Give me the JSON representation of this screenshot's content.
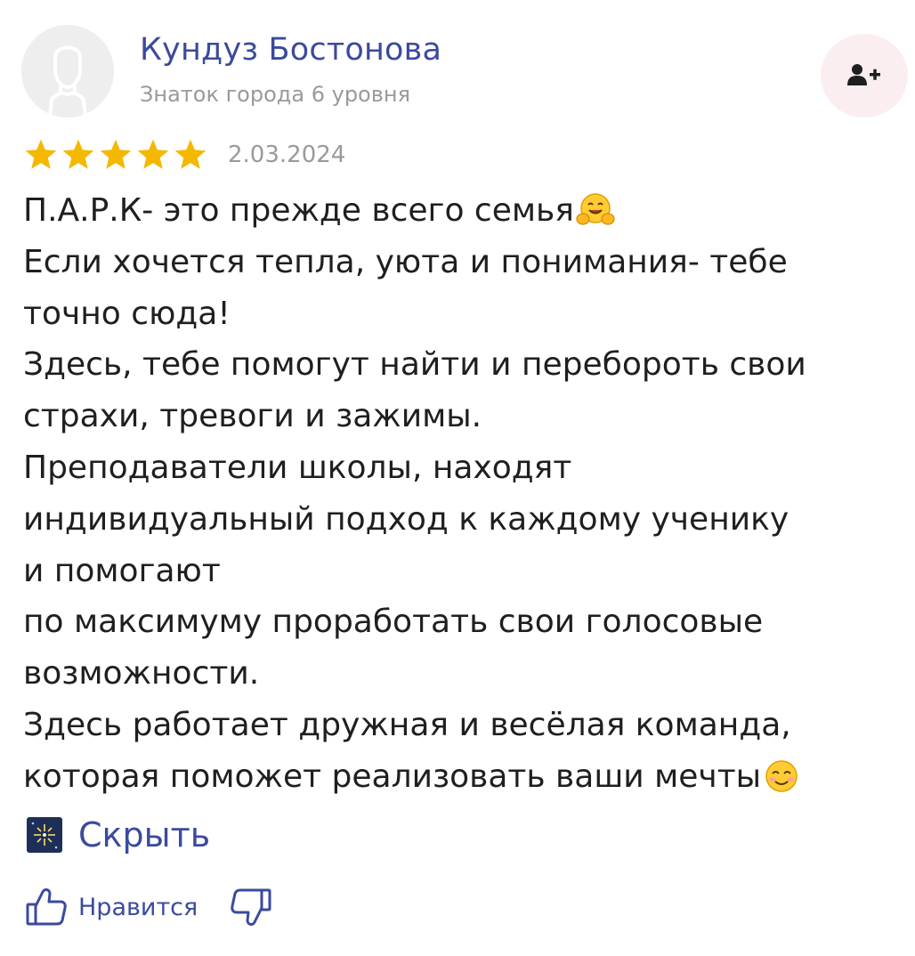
{
  "review": {
    "author": {
      "name": "Кундуз Бостонова",
      "level": "Знаток города 6 уровня"
    },
    "rating": 5,
    "rating_max": 5,
    "date": "2.03.2024",
    "text_lines": [
      "П.А.Р.К- это прежде всего семья",
      "Если хочется тепла, уюта и понимания- тебе",
      "точно сюда!",
      "Здесь, тебе помогут найти и перебороть свои",
      "страхи, тревоги и зажимы.",
      "Преподаватели школы, находят",
      "индивидуальный подход к каждому ученику",
      "и помогают",
      "по максимуму проработать свои голосовые",
      "возможности.",
      "Здесь работает дружная и весёлая команда,",
      "которая поможет реализовать ваши мечты"
    ],
    "hide_label": "Скрыть",
    "like_label": "Нравится"
  },
  "colors": {
    "link": "#3b4a9e",
    "muted": "#9a9a9a",
    "star": "#f5b800",
    "subscribe_bg": "#fbeef0",
    "avatar_bg": "#eeeeee"
  },
  "icons": {
    "subscribe": "add-user-icon",
    "line1_emoji": "hugging-face-emoji",
    "line12_emoji": "smiling-face-emoji",
    "hide": "fireworks-icon",
    "like": "thumbs-up-icon",
    "dislike": "thumbs-down-icon"
  }
}
